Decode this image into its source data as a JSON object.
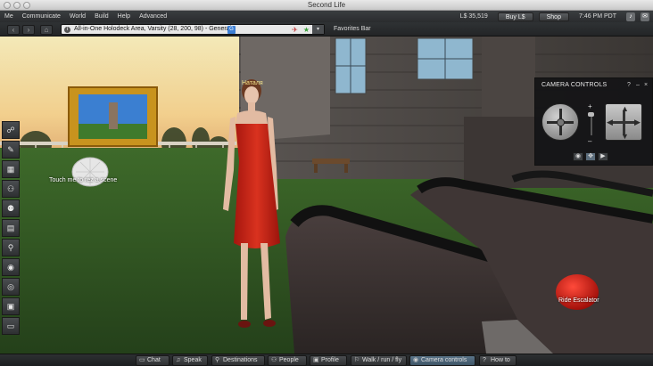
{
  "window": {
    "title": "Second Life"
  },
  "menubar": {
    "items": [
      "Me",
      "Communicate",
      "World",
      "Build",
      "Help",
      "Advanced"
    ],
    "balance": "L$ 35,519",
    "buy_label": "Buy L$",
    "shop_label": "Shop",
    "time": "7:46 PM PDT"
  },
  "navbar": {
    "location": "All-in-One Holodeck Area, Varsity (28, 200, 98) - General",
    "rating_badge": "G",
    "favorites_label": "Favorites Bar"
  },
  "scene": {
    "avatar_name": "Наталя",
    "touch_label": "Touch me to rez a scene",
    "escalator_label": "Ride Escalator"
  },
  "left_toolbar": {
    "icons": [
      "gestures-icon",
      "build-icon",
      "map-icon",
      "people-icon",
      "appearance-icon",
      "inventory-icon",
      "search-icon",
      "voice-icon",
      "places-icon",
      "snapshot-icon",
      "chat-log-icon"
    ]
  },
  "camera_controls": {
    "title": "CAMERA CONTROLS",
    "help_glyph": "?",
    "minimize_glyph": "–",
    "close_glyph": "×",
    "zoom_in_glyph": "+",
    "zoom_out_glyph": "–"
  },
  "bottom_bar": {
    "buttons": [
      {
        "label": "Chat"
      },
      {
        "label": "Speak"
      },
      {
        "label": "Destinations"
      },
      {
        "label": "People"
      },
      {
        "label": "Profile"
      },
      {
        "label": "Walk / run / fly"
      },
      {
        "label": "Camera controls"
      },
      {
        "label": "How to"
      }
    ]
  }
}
